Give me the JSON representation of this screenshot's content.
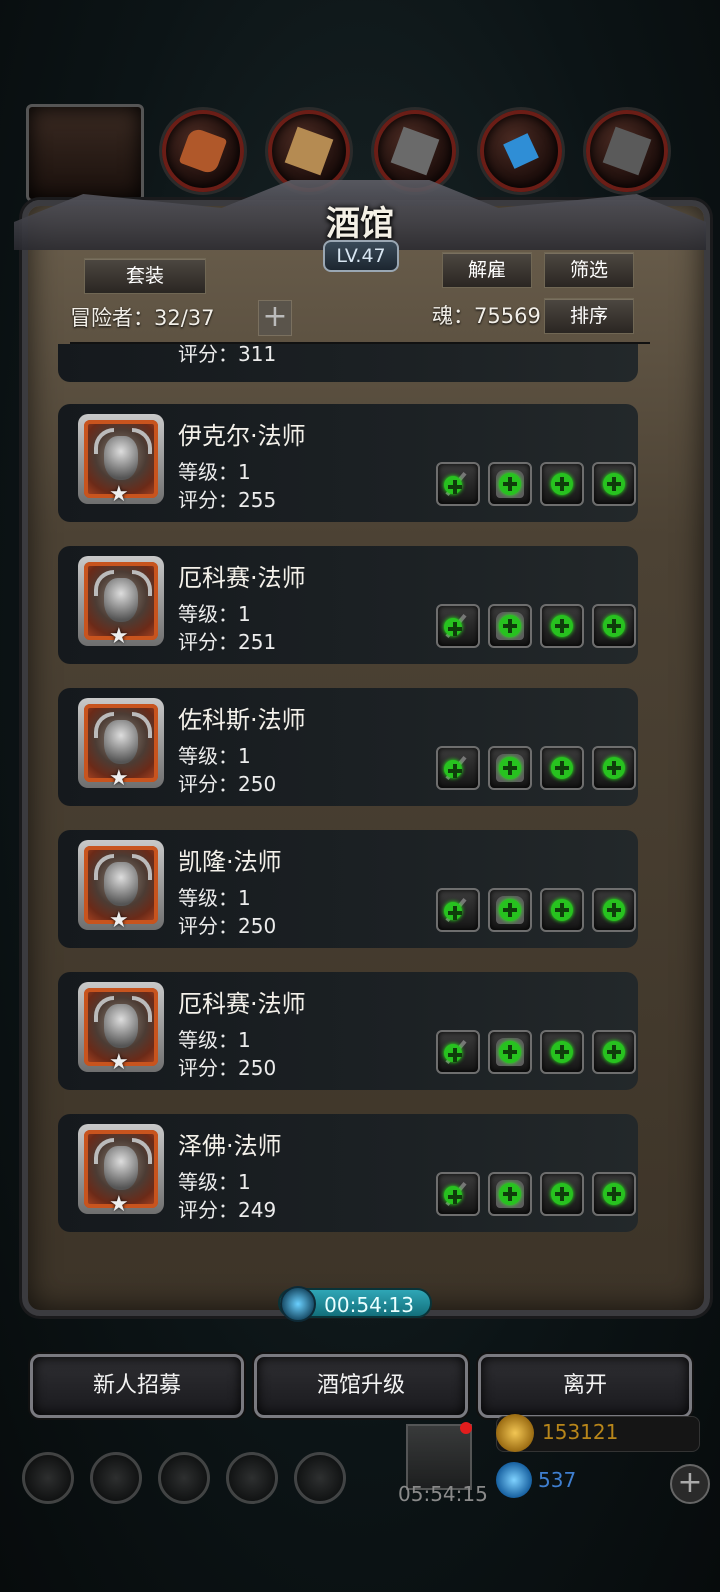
{
  "header": {
    "title": "酒馆",
    "level": "LV.47",
    "set_label": "套装",
    "adventurers_label": "冒险者：32/37",
    "add_label": "+",
    "dismiss_label": "解雇",
    "filter_label": "筛选",
    "soul_label": "魂：75569",
    "sort_label": "排序"
  },
  "top_tabs": [
    {
      "icon": "portrait-tab-icon"
    },
    {
      "icon": "boots-icon",
      "color": "#b0582a"
    },
    {
      "icon": "wood-icon",
      "color": "#b58b52"
    },
    {
      "icon": "ore-icon",
      "color": "#6a6a6a"
    },
    {
      "icon": "crystal-icon",
      "color": "#2f8ed6"
    },
    {
      "icon": "metal-icon",
      "color": "#5a5a5a"
    }
  ],
  "partial_card": {
    "score": "评分：311"
  },
  "adventurers": [
    {
      "name": "伊克尔·法师",
      "level": "等级：1",
      "score": "评分：255"
    },
    {
      "name": "厄科赛·法师",
      "level": "等级：1",
      "score": "评分：251"
    },
    {
      "name": "佐科斯·法师",
      "level": "等级：1",
      "score": "评分：250"
    },
    {
      "name": "凯隆·法师",
      "level": "等级：1",
      "score": "评分：250"
    },
    {
      "name": "厄科赛·法师",
      "level": "等级：1",
      "score": "评分：250"
    },
    {
      "name": "泽佛·法师",
      "level": "等级：1",
      "score": "评分：249"
    }
  ],
  "timer": "00:54:13",
  "actions": {
    "recruit": "新人招募",
    "upgrade": "酒馆升级",
    "leave": "离开"
  },
  "footer": {
    "gift_timer": "05:54:15",
    "gold": "153121",
    "gems": "537",
    "add": "+"
  }
}
